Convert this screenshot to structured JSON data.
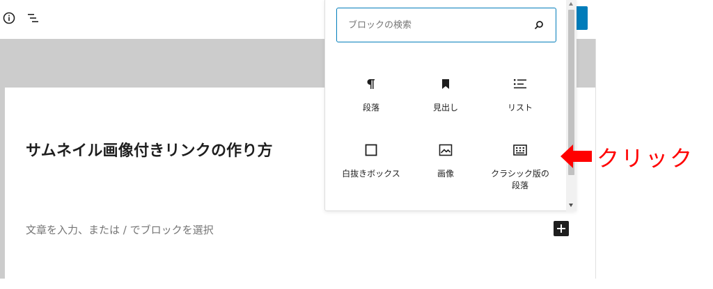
{
  "toolbar": {
    "icons": [
      "info-icon",
      "list-view-icon"
    ]
  },
  "editor": {
    "title": "サムネイル画像付きリンクの作り方",
    "placeholder": "文章を入力、または / でブロックを選択"
  },
  "inserter": {
    "search_placeholder": "ブロックの検索",
    "blocks": [
      {
        "label": "段落",
        "icon": "paragraph-icon"
      },
      {
        "label": "見出し",
        "icon": "bookmark-heading-icon"
      },
      {
        "label": "リスト",
        "icon": "list-icon"
      },
      {
        "label": "白抜きボックス",
        "icon": "square-icon"
      },
      {
        "label": "画像",
        "icon": "image-icon"
      },
      {
        "label": "クラシック版の段落",
        "icon": "keyboard-icon"
      }
    ]
  },
  "annotation": {
    "text": "クリック",
    "color": "#ff0000"
  },
  "colors": {
    "accent": "#007cba",
    "canvas_gray": "#cccccc"
  }
}
